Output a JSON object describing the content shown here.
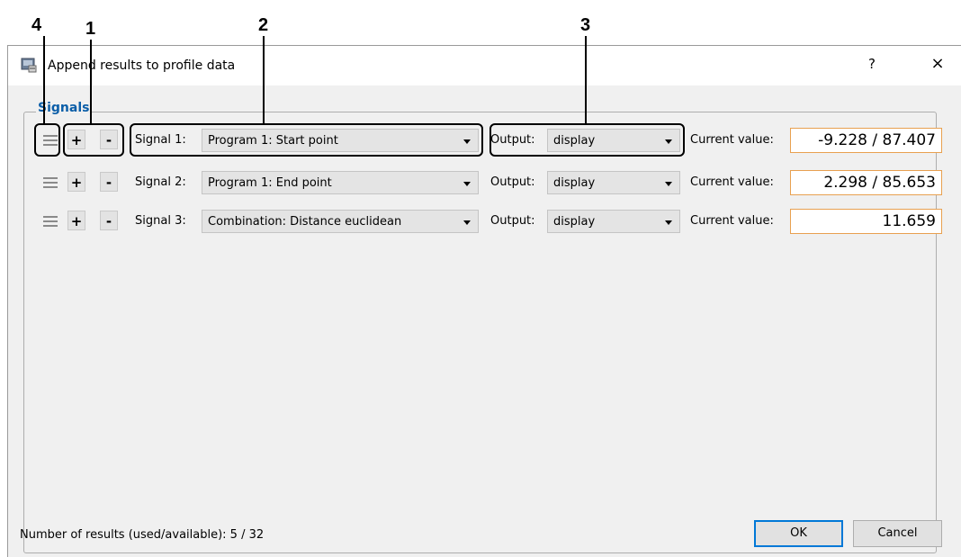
{
  "callouts": [
    "4",
    "1",
    "2",
    "3"
  ],
  "dialog": {
    "title": "Append results to profile data",
    "help_label": "?",
    "close_label": "×"
  },
  "group": {
    "title": "Signals"
  },
  "rows": [
    {
      "label": "Signal 1:",
      "signal": "Program 1: Start point",
      "output_label": "Output:",
      "output": "display",
      "cv_label": "Current value:",
      "value": "-9.228 / 87.407"
    },
    {
      "label": "Signal 2:",
      "signal": "Program 1: End point",
      "output_label": "Output:",
      "output": "display",
      "cv_label": "Current value:",
      "value": "2.298 / 85.653"
    },
    {
      "label": "Signal 3:",
      "signal": "Combination: Distance euclidean",
      "output_label": "Output:",
      "output": "display",
      "cv_label": "Current value:",
      "value": "11.659"
    }
  ],
  "buttons": {
    "add": "+",
    "remove": "-",
    "ok": "OK",
    "cancel": "Cancel"
  },
  "footer": {
    "status": "Number of results (used/available): 5 / 32"
  },
  "colors": {
    "accent": "#0b5ea8",
    "value_border": "#e8a050"
  }
}
